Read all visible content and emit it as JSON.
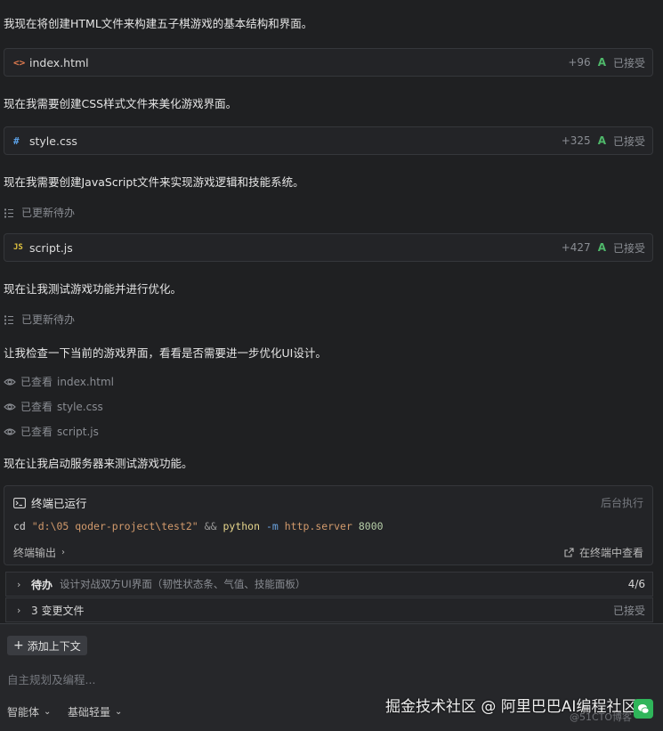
{
  "messages": {
    "m1": "我现在将创建HTML文件来构建五子棋游戏的基本结构和界面。",
    "m2": "现在我需要创建CSS样式文件来美化游戏界面。",
    "m3": "现在我需要创建JavaScript文件来实现游戏逻辑和技能系统。",
    "m4": "现在让我测试游戏功能并进行优化。",
    "m5": "让我检查一下当前的游戏界面，看看是否需要进一步优化UI设计。",
    "m6": "现在让我启动服务器来测试游戏功能。"
  },
  "files": [
    {
      "icon": "<>",
      "icon_color": "#e07b4f",
      "name": "index.html",
      "added": "+96",
      "accept_mark": "A",
      "status": "已接受"
    },
    {
      "icon": "#",
      "icon_color": "#5aa0e6",
      "name": "style.css",
      "added": "+325",
      "accept_mark": "A",
      "status": "已接受"
    },
    {
      "icon": "JS",
      "icon_color": "#e0c33f",
      "name": "script.js",
      "added": "+427",
      "accept_mark": "A",
      "status": "已接受"
    }
  ],
  "todo_updated": "已更新待办",
  "viewed": [
    {
      "label": "已查看",
      "file": "index.html"
    },
    {
      "label": "已查看",
      "file": "style.css"
    },
    {
      "label": "已查看",
      "file": "script.js"
    }
  ],
  "terminal": {
    "title": "终端已运行",
    "background": "后台执行",
    "cmd_cd": "cd",
    "cmd_path": "\"d:\\05 qoder-project\\test2\"",
    "cmd_amp": "&&",
    "cmd_python": "python",
    "cmd_flag": "-m",
    "cmd_module": "http.server",
    "cmd_port": "8000",
    "output_label": "终端输出",
    "open_label": "在终端中查看"
  },
  "todo_panel": {
    "label": "待办",
    "text": "设计对战双方UI界面（韧性状态条、气值、技能面板）",
    "count": "4/6"
  },
  "changes_panel": {
    "label": "3 变更文件",
    "status": "已接受"
  },
  "composer": {
    "add_context": "添加上下文",
    "placeholder": "自主规划及编程...",
    "mode_agent": "智能体",
    "mode_model": "基础轻量"
  },
  "watermark": {
    "text": "掘金技术社区 @ 阿里巴巴AI编程社区",
    "sub": "@51CTO博客"
  }
}
